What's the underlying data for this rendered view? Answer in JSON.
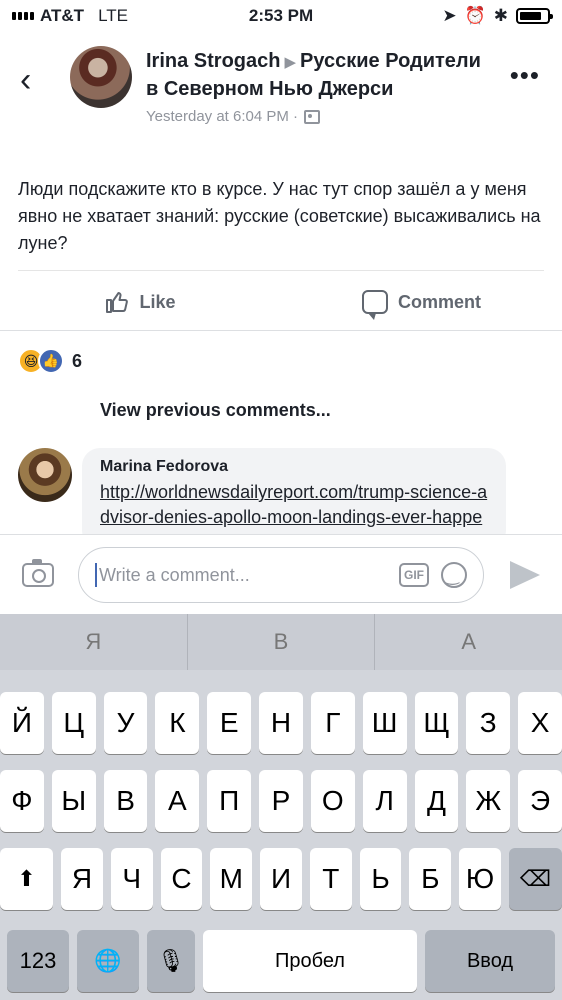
{
  "status_bar": {
    "carrier": "AT&T",
    "network": "LTE",
    "time": "2:53 PM"
  },
  "post": {
    "author": "Irina Strogach",
    "group": "Русские Родители в Северном Нью Джерси",
    "timestamp": "Yesterday at 6:04 PM ·",
    "text": "Люди подскажите кто в курсе. У нас тут спор зашёл а у меня явно не хватает знаний: русские (советские) высаживались на луне?",
    "like_label": "Like",
    "comment_label": "Comment",
    "reaction_count": "6"
  },
  "comments": {
    "view_previous": "View previous comments...",
    "items": [
      {
        "author": "Marina Fedorova",
        "text": "http://worldnewsdailyreport.com/trump-science-advisor-denies-apollo-moon-landings-ever-happened/"
      }
    ]
  },
  "composer": {
    "placeholder": "Write a comment...",
    "gif_label": "GIF"
  },
  "keyboard": {
    "suggestions": [
      "Я",
      "В",
      "А"
    ],
    "row1": [
      "Й",
      "Ц",
      "У",
      "К",
      "Е",
      "Н",
      "Г",
      "Ш",
      "Щ",
      "З",
      "Х"
    ],
    "row2": [
      "Ф",
      "Ы",
      "В",
      "А",
      "П",
      "Р",
      "О",
      "Л",
      "Д",
      "Ж",
      "Э"
    ],
    "row3": [
      "Я",
      "Ч",
      "С",
      "М",
      "И",
      "Т",
      "Ь",
      "Б",
      "Ю"
    ],
    "numbers_label": "123",
    "space_label": "Пробел",
    "enter_label": "Ввод"
  }
}
